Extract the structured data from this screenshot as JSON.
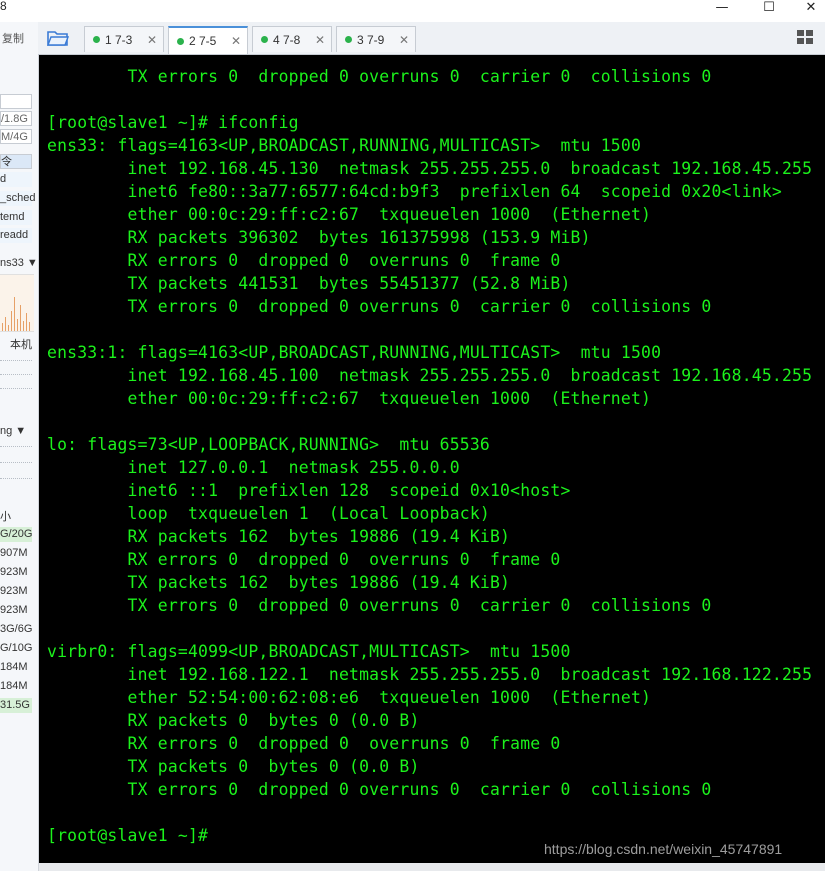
{
  "window": {
    "title_fragment": "8",
    "minimize_label": "—",
    "maximize_label": "☐",
    "close_label": "✕"
  },
  "side_panel": {
    "copy_label": "复制",
    "fields": [
      "/1.8G",
      "M/4G"
    ],
    "process_items": [
      "令",
      "d",
      "_sched",
      "temd",
      "readd"
    ],
    "iface_label": "ns33",
    "local_label": "本机",
    "ping_label": "ng",
    "size_header": "小",
    "disk_rows": [
      "G/20G",
      "907M",
      "923M",
      "923M",
      "923M",
      "3G/6G",
      "G/10G",
      "184M",
      "184M",
      "31.5G"
    ]
  },
  "tabs": [
    {
      "label": "1 7-3",
      "active": false
    },
    {
      "label": "2 7-5",
      "active": true
    },
    {
      "label": "4 7-8",
      "active": false
    },
    {
      "label": "3 7-9",
      "active": false
    }
  ],
  "terminal": {
    "lines": [
      "        TX errors 0  dropped 0 overruns 0  carrier 0  collisions 0",
      "",
      "[root@slave1 ~]# ifconfig",
      "ens33: flags=4163<UP,BROADCAST,RUNNING,MULTICAST>  mtu 1500",
      "        inet 192.168.45.130  netmask 255.255.255.0  broadcast 192.168.45.255",
      "        inet6 fe80::3a77:6577:64cd:b9f3  prefixlen 64  scopeid 0x20<link>",
      "        ether 00:0c:29:ff:c2:67  txqueuelen 1000  (Ethernet)",
      "        RX packets 396302  bytes 161375998 (153.9 MiB)",
      "        RX errors 0  dropped 0  overruns 0  frame 0",
      "        TX packets 441531  bytes 55451377 (52.8 MiB)",
      "        TX errors 0  dropped 0 overruns 0  carrier 0  collisions 0",
      "",
      "ens33:1: flags=4163<UP,BROADCAST,RUNNING,MULTICAST>  mtu 1500",
      "        inet 192.168.45.100  netmask 255.255.255.0  broadcast 192.168.45.255",
      "        ether 00:0c:29:ff:c2:67  txqueuelen 1000  (Ethernet)",
      "",
      "lo: flags=73<UP,LOOPBACK,RUNNING>  mtu 65536",
      "        inet 127.0.0.1  netmask 255.0.0.0",
      "        inet6 ::1  prefixlen 128  scopeid 0x10<host>",
      "        loop  txqueuelen 1  (Local Loopback)",
      "        RX packets 162  bytes 19886 (19.4 KiB)",
      "        RX errors 0  dropped 0  overruns 0  frame 0",
      "        TX packets 162  bytes 19886 (19.4 KiB)",
      "        TX errors 0  dropped 0 overruns 0  carrier 0  collisions 0",
      "",
      "virbr0: flags=4099<UP,BROADCAST,MULTICAST>  mtu 1500",
      "        inet 192.168.122.1  netmask 255.255.255.0  broadcast 192.168.122.255",
      "        ether 52:54:00:62:08:e6  txqueuelen 1000  (Ethernet)",
      "        RX packets 0  bytes 0 (0.0 B)",
      "        RX errors 0  dropped 0  overruns 0  frame 0",
      "        TX packets 0  bytes 0 (0.0 B)",
      "        TX errors 0  dropped 0 overruns 0  carrier 0  collisions 0",
      "",
      "[root@slave1 ~]#"
    ],
    "watermark": "https://blog.csdn.net/weixin_45747891"
  },
  "colors": {
    "terminal_bg": "#000000",
    "terminal_fg": "#1cf21c",
    "tab_active_accent": "#4a90d9",
    "tab_status_dot": "#2bb24c"
  }
}
